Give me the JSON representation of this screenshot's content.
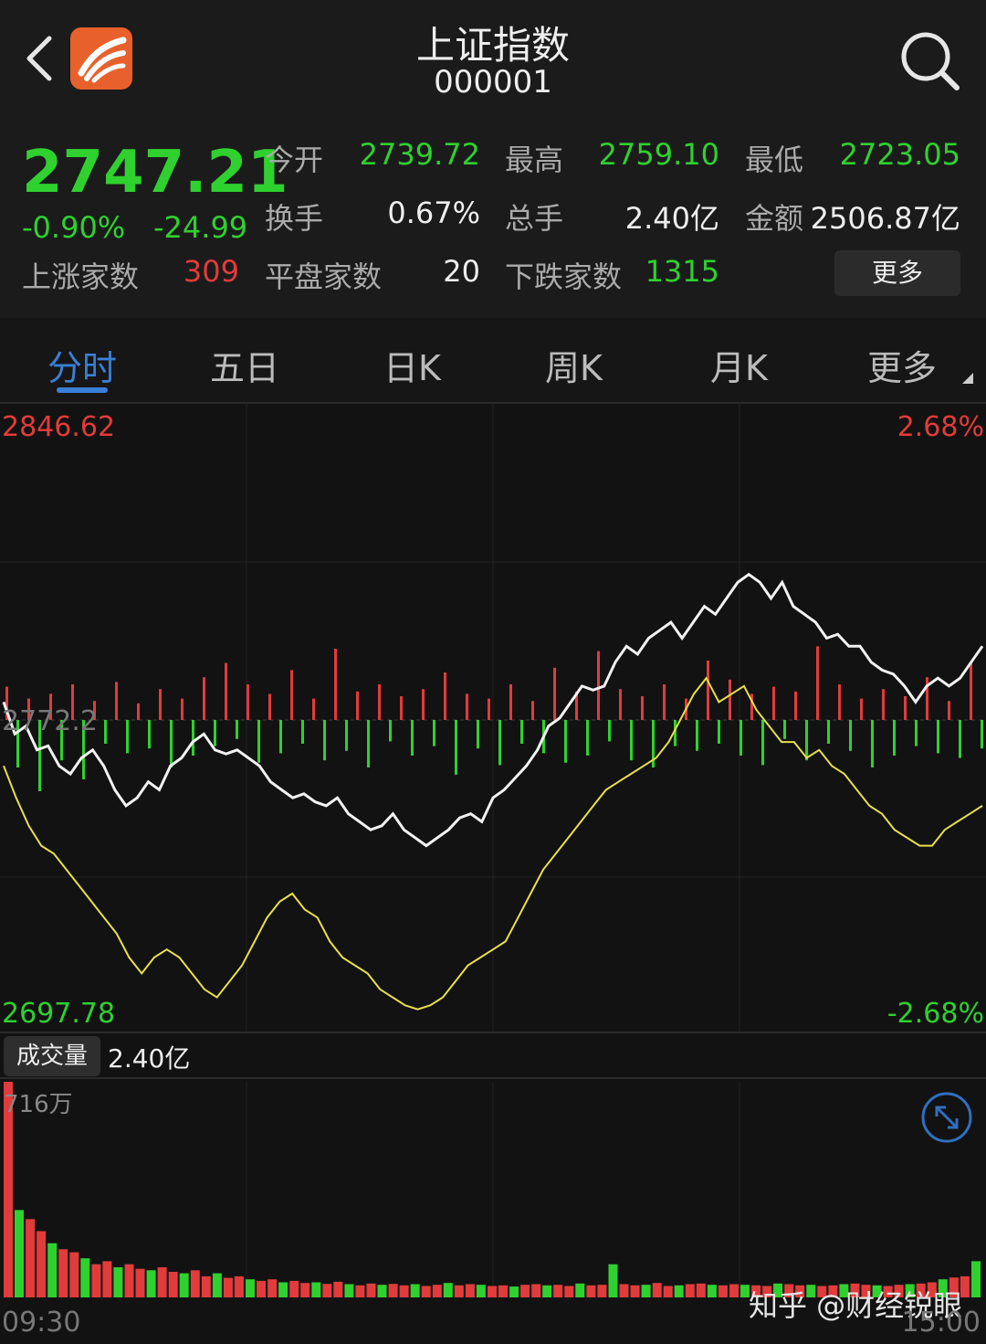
{
  "header": {
    "title": "上证指数",
    "code": "000001"
  },
  "quote": {
    "price": "2747.21",
    "change_pct": "-0.90%",
    "change": "-24.99",
    "rows": [
      [
        {
          "label": "今开",
          "value": "2739.72",
          "color": "g"
        },
        {
          "label": "最高",
          "value": "2759.10",
          "color": "g"
        },
        {
          "label": "最低",
          "value": "2723.05",
          "color": "g"
        }
      ],
      [
        {
          "label": "换手",
          "value": "0.67%",
          "color": "w"
        },
        {
          "label": "总手",
          "value": "2.40亿",
          "color": "w"
        },
        {
          "label": "金额",
          "value": "2506.87亿",
          "color": "w"
        }
      ]
    ],
    "breadth": {
      "up_label": "上涨家数",
      "up_value": "309",
      "flat_label": "平盘家数",
      "flat_value": "20",
      "down_label": "下跌家数",
      "down_value": "1315"
    },
    "more_button": "更多"
  },
  "tabs": [
    "分时",
    "五日",
    "日K",
    "周K",
    "月K",
    "更多"
  ],
  "active_tab": 0,
  "chart_data": {
    "type": "line",
    "y_max": 2846.62,
    "y_min": 2697.78,
    "pre_close": 2772.2,
    "pct_max": "2.68%",
    "pct_min": "-2.68%",
    "x_start": "09:30",
    "x_end": "15:00",
    "price_series": [
      2776,
      2768,
      2770,
      2764,
      2765,
      2760,
      2758,
      2762,
      2764,
      2760,
      2754,
      2750,
      2752,
      2756,
      2754,
      2760,
      2762,
      2766,
      2768,
      2764,
      2763,
      2764,
      2762,
      2760,
      2756,
      2754,
      2752,
      2753,
      2751,
      2750,
      2752,
      2748,
      2746,
      2744,
      2745,
      2748,
      2744,
      2742,
      2740,
      2742,
      2744,
      2747,
      2748,
      2746,
      2752,
      2754,
      2757,
      2760,
      2764,
      2770,
      2772,
      2776,
      2780,
      2779,
      2780,
      2786,
      2790,
      2788,
      2792,
      2794,
      2796,
      2792,
      2796,
      2800,
      2798,
      2802,
      2806,
      2808,
      2806,
      2802,
      2806,
      2800,
      2798,
      2796,
      2792,
      2793,
      2790,
      2790,
      2786,
      2784,
      2783,
      2780,
      2776,
      2780,
      2782,
      2780,
      2782,
      2786,
      2790
    ],
    "avg_series": [
      2760,
      2752,
      2745,
      2740,
      2738,
      2734,
      2730,
      2726,
      2722,
      2718,
      2712,
      2708,
      2712,
      2714,
      2712,
      2708,
      2704,
      2702,
      2706,
      2710,
      2716,
      2722,
      2726,
      2728,
      2724,
      2722,
      2716,
      2712,
      2710,
      2708,
      2704,
      2702,
      2700,
      2699,
      2700,
      2702,
      2706,
      2710,
      2712,
      2714,
      2716,
      2722,
      2728,
      2734,
      2738,
      2742,
      2746,
      2750,
      2754,
      2756,
      2758,
      2760,
      2762,
      2766,
      2772,
      2778,
      2782,
      2776,
      2778,
      2780,
      2774,
      2770,
      2766,
      2766,
      2762,
      2764,
      2760,
      2758,
      2754,
      2750,
      2748,
      2744,
      2742,
      2740,
      2740,
      2744,
      2746,
      2748,
      2750
    ],
    "breadth_bars": [
      28,
      -40,
      18,
      -60,
      22,
      -34,
      30,
      -50,
      16,
      -20,
      32,
      -28,
      14,
      -24,
      26,
      -40,
      18,
      -30,
      36,
      -22,
      48,
      -16,
      30,
      -36,
      22,
      -28,
      42,
      -20,
      18,
      -34,
      60,
      -26,
      24,
      -40,
      30,
      -18,
      20,
      -30,
      26,
      -22,
      40,
      -46,
      22,
      -24,
      18,
      -38,
      30,
      -20,
      16,
      -28,
      44,
      -36,
      24,
      -30,
      58,
      -18,
      26,
      -34,
      20,
      -40,
      30,
      -22,
      18,
      -26,
      50,
      -20,
      34,
      -30,
      22,
      -38,
      28,
      -16,
      24,
      -34,
      62,
      -20,
      30,
      -26,
      18,
      -40,
      26,
      -30,
      20,
      -22,
      36,
      -28,
      16,
      -32,
      48,
      -24
    ],
    "volume": [
      716,
      290,
      260,
      220,
      180,
      160,
      150,
      130,
      110,
      120,
      100,
      110,
      95,
      90,
      100,
      85,
      80,
      90,
      70,
      80,
      65,
      70,
      60,
      55,
      60,
      50,
      55,
      48,
      50,
      45,
      52,
      44,
      40,
      46,
      42,
      45,
      40,
      44,
      38,
      42,
      48,
      40,
      44,
      42,
      38,
      40,
      36,
      42,
      44,
      40,
      42,
      38,
      46,
      40,
      42,
      110,
      44,
      40,
      42,
      48,
      38,
      40,
      44,
      46,
      42,
      40,
      44,
      42,
      40,
      38,
      46,
      44,
      40,
      42,
      38,
      40,
      44,
      46,
      42,
      40,
      38,
      42,
      44,
      46,
      50,
      60,
      66,
      70,
      120
    ]
  },
  "volume_panel": {
    "label": "成交量",
    "total": "2.40亿",
    "max_label": "716万"
  },
  "watermark": "知乎 @财经锐眼",
  "colors": {
    "up": "#e23b3b",
    "down": "#2fd12f",
    "accent": "#3a7fd6",
    "price_line": "#f2f2f2",
    "avg_line": "#e8e04a"
  }
}
